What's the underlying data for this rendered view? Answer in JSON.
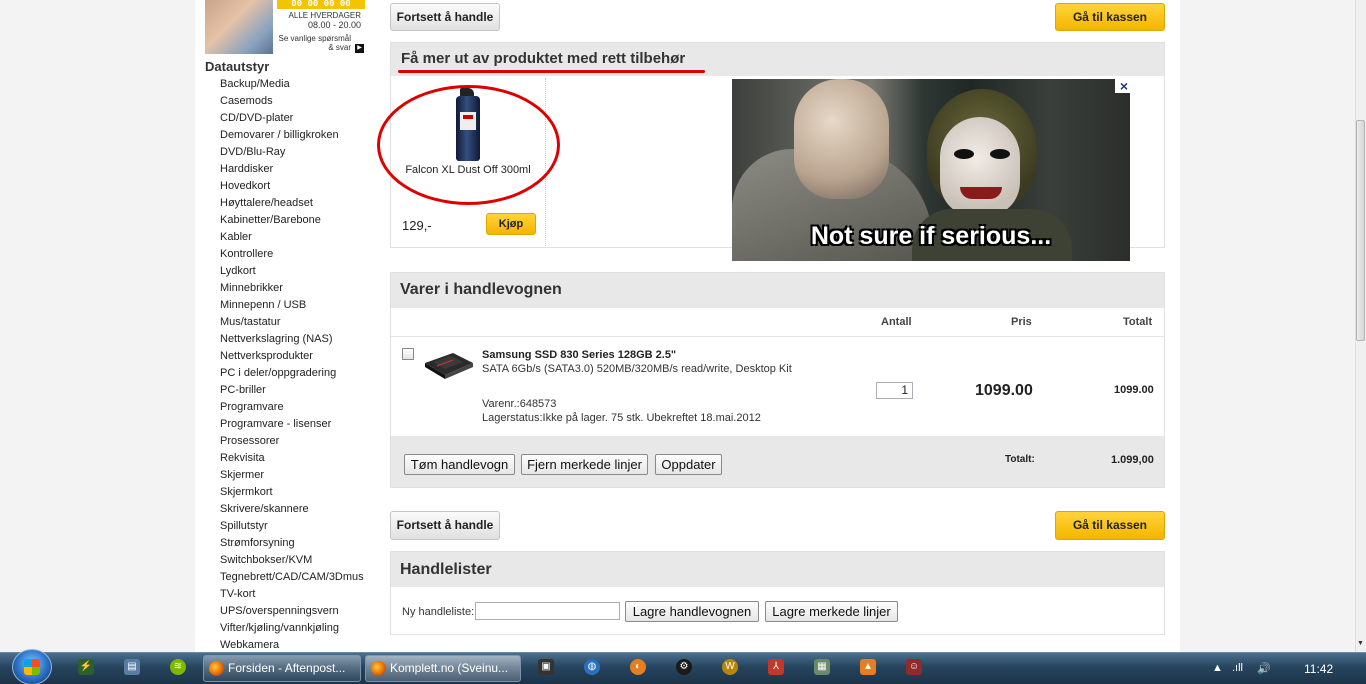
{
  "promo": {
    "phone": "00 00 00 00",
    "hours_label": "ALLE HVERDAGER",
    "hours": "08.00 - 20.00",
    "faq": "Se vanlige spørsmål & svar",
    "arrow": "▶"
  },
  "sidebar": {
    "title": "Datautstyr",
    "items": [
      "Backup/Media",
      "Casemods",
      "CD/DVD-plater",
      "Demovarer / billigkroken",
      "DVD/Blu-Ray",
      "Harddisker",
      "Hovedkort",
      "Høyttalere/headset",
      "Kabinetter/Barebone",
      "Kabler",
      "Kontrollere",
      "Lydkort",
      "Minnebrikker",
      "Minnepenn / USB",
      "Mus/tastatur",
      "Nettverkslagring (NAS)",
      "Nettverksprodukter",
      "PC i deler/oppgradering",
      "PC-briller",
      "Programvare",
      "Programvare - lisenser",
      "Prosessorer",
      "Rekvisita",
      "Skjermer",
      "Skjermkort",
      "Skrivere/skannere",
      "Spillutstyr",
      "Strømforsyning",
      "Switchbokser/KVM",
      "Tegnebrett/CAD/CAM/3Dmus",
      "TV-kort",
      "UPS/overspenningsvern",
      "Vifter/kjøling/vannkjøling",
      "Webkamera"
    ]
  },
  "top_actions": {
    "continue_label": "Fortsett å handle",
    "checkout_label": "Gå til kassen"
  },
  "accessory": {
    "title": "Få mer ut av produktet med rett tilbehør",
    "product_name": "Falcon XL Dust Off 300ml",
    "price": "129,-",
    "buy_label": "Kjøp"
  },
  "meme": {
    "caption": "Not sure if serious...",
    "close": "×"
  },
  "cart": {
    "title": "Varer i handlevognen",
    "columns": {
      "qty": "Antall",
      "price": "Pris",
      "total": "Totalt"
    },
    "item": {
      "name": "Samsung SSD 830 Series 128GB 2.5\"",
      "desc": "SATA 6Gb/s (SATA3.0) 520MB/320MB/s read/write, Desktop Kit",
      "sku": "Varenr.:648573",
      "stock": "Lagerstatus:Ikke på lager. 75 stk. Ubekreftet 18.mai.2012",
      "qty": "1",
      "price": "1099.00",
      "total": "1099.00"
    },
    "buttons": {
      "empty": "Tøm handlevogn",
      "remove_marked": "Fjern merkede linjer",
      "update": "Oppdater"
    },
    "sum_label": "Totalt:",
    "sum_value": "1.099,00"
  },
  "bottom_actions": {
    "continue_label": "Fortsett å handle",
    "checkout_label": "Gå til kassen"
  },
  "lists": {
    "title": "Handlelister",
    "new_label": "Ny handleliste:",
    "new_value": "",
    "save_cart": "Lagre handlevognen",
    "save_marked": "Lagre merkede linjer"
  },
  "taskbar": {
    "task1": "Forsiden - Aftenpost...",
    "task2": "Komplett.no (Sveinu...",
    "time": "11:42",
    "tray_arrow": "▲",
    "tray_signal": ".ıll",
    "tray_volume": "🔊"
  },
  "colors": {
    "accent_yellow": "#f4b500",
    "annotation_red": "#dd0000",
    "taskbar": "#27445e"
  }
}
